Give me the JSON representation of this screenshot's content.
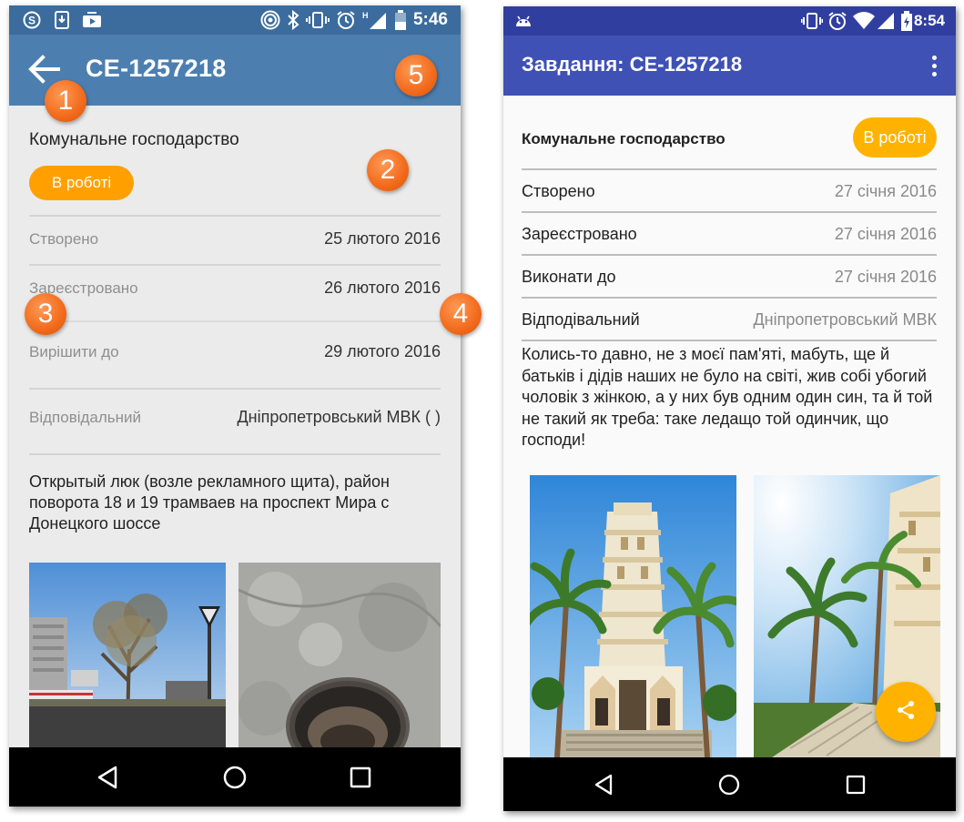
{
  "left_phone": {
    "status_bar": {
      "time": "5:46"
    },
    "app_bar": {
      "title": "CE-1257218"
    },
    "department": "Комунальне господарство",
    "status_pill": "В роботі",
    "rows": [
      {
        "label": "Створено",
        "value": "25 лютого 2016"
      },
      {
        "label": "Зареєстровано",
        "value": "26 лютого 2016"
      },
      {
        "label": "Вирішити до",
        "value": "29 лютого 2016"
      },
      {
        "label": "Відповідальний",
        "value": "Дніпропетровський МВК ( )"
      }
    ],
    "description": "Открытый люк (возле рекламного щита), район поворота 18 и 19 трамваев на проспект Мира с Донецкого шоссе"
  },
  "right_phone": {
    "status_bar": {
      "time": "8:54"
    },
    "app_bar": {
      "title": "Завдання: CE-1257218"
    },
    "department": "Комунальне господарство",
    "status_pill": "В роботі",
    "rows": [
      {
        "label": "Створено",
        "value": "27 січня 2016"
      },
      {
        "label": "Зареєстровано",
        "value": "27 січня 2016"
      },
      {
        "label": "Виконати до",
        "value": "27 січня 2016"
      },
      {
        "label": "Відподівальний",
        "value": "Дніпропетровський МВК"
      }
    ],
    "description": "Колись-то давно, не з моєї пам'яті, мабуть, ще й батьків і дідів наших не було на світі, жив собі убогий чоловік з жінкою, а у них був одним один син, та й той не такий як треба: таке ледащо той одинчик, що господи!"
  },
  "callouts": [
    "1",
    "2",
    "3",
    "4",
    "5"
  ],
  "colors": {
    "left_appbar": "#4c7fb0",
    "left_statusbar": "#3b6c9d",
    "right_appbar": "#3f51b5",
    "right_statusbar": "#303f9f",
    "accent_orange": "#ffa000",
    "badge_orange": "#f26a1b"
  },
  "icons": {
    "left_status_left": [
      "skype-icon",
      "download-icon",
      "media-icon"
    ],
    "left_status_right": [
      "hotspot-icon",
      "bluetooth-icon",
      "vibrate-icon",
      "alarm-icon",
      "signal-icon",
      "battery-icon"
    ],
    "right_status_left": [
      "android-icon"
    ],
    "right_status_right": [
      "vibrate-icon",
      "alarm-icon",
      "wifi-icon",
      "signal-icon",
      "battery-charging-icon"
    ],
    "nav": [
      "back-nav-icon",
      "home-nav-icon",
      "recents-nav-icon"
    ],
    "fab": "share-icon",
    "appbar_left": "back-arrow-icon",
    "appbar_right": "overflow-menu-icon"
  }
}
